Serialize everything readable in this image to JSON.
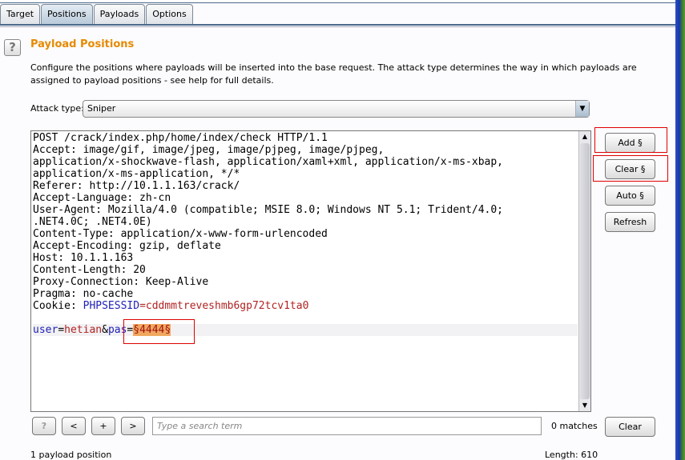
{
  "tabs": [
    {
      "label": "Target"
    },
    {
      "label": "Positions",
      "active": true
    },
    {
      "label": "Payloads"
    },
    {
      "label": "Options"
    }
  ],
  "section": {
    "title": "Payload Positions",
    "description": "Configure the positions where payloads will be inserted into the base request. The attack type determines the way in which payloads are assigned to payload positions - see help for full details.",
    "help_icon": "?"
  },
  "attack_type": {
    "label": "Attack type:",
    "value": "Sniper"
  },
  "request": {
    "lines": [
      "POST /crack/index.php/home/index/check HTTP/1.1",
      "Accept: image/gif, image/jpeg, image/pjpeg, image/pjpeg,",
      "application/x-shockwave-flash, application/xaml+xml, application/x-ms-xbap,",
      "application/x-ms-application, */*",
      "Referer: http://10.1.1.163/crack/",
      "Accept-Language: zh-cn",
      "User-Agent: Mozilla/4.0 (compatible; MSIE 8.0; Windows NT 5.1; Trident/4.0;",
      ".NET4.0C; .NET4.0E)",
      "Content-Type: application/x-www-form-urlencoded",
      "Accept-Encoding: gzip, deflate",
      "Host: 10.1.1.163",
      "Content-Length: 20",
      "Proxy-Connection: Keep-Alive",
      "Pragma: no-cache"
    ],
    "cookie": {
      "label": "Cookie: ",
      "name": "PHPSESSID",
      "eq": "=",
      "value": "cddmmtreveshmb6gp72tcv1ta0"
    },
    "body": {
      "p1": "user",
      "eq1": "=",
      "v1": "hetian",
      "amp": "&",
      "p2": "pas",
      "eq2": "=",
      "payload": "§4444§"
    }
  },
  "buttons": {
    "add": "Add §",
    "clear": "Clear §",
    "auto": "Auto §",
    "refresh": "Refresh"
  },
  "search": {
    "help": "?",
    "prev": "<",
    "add": "+",
    "next": ">",
    "placeholder": "Type a search term",
    "matches": "0 matches",
    "clear": "Clear"
  },
  "status": {
    "positions": "1 payload position",
    "length": "Length: 610"
  },
  "colors": {
    "title": "#e58a00",
    "highlight": "#f0a860",
    "annotation": "#e00000"
  }
}
